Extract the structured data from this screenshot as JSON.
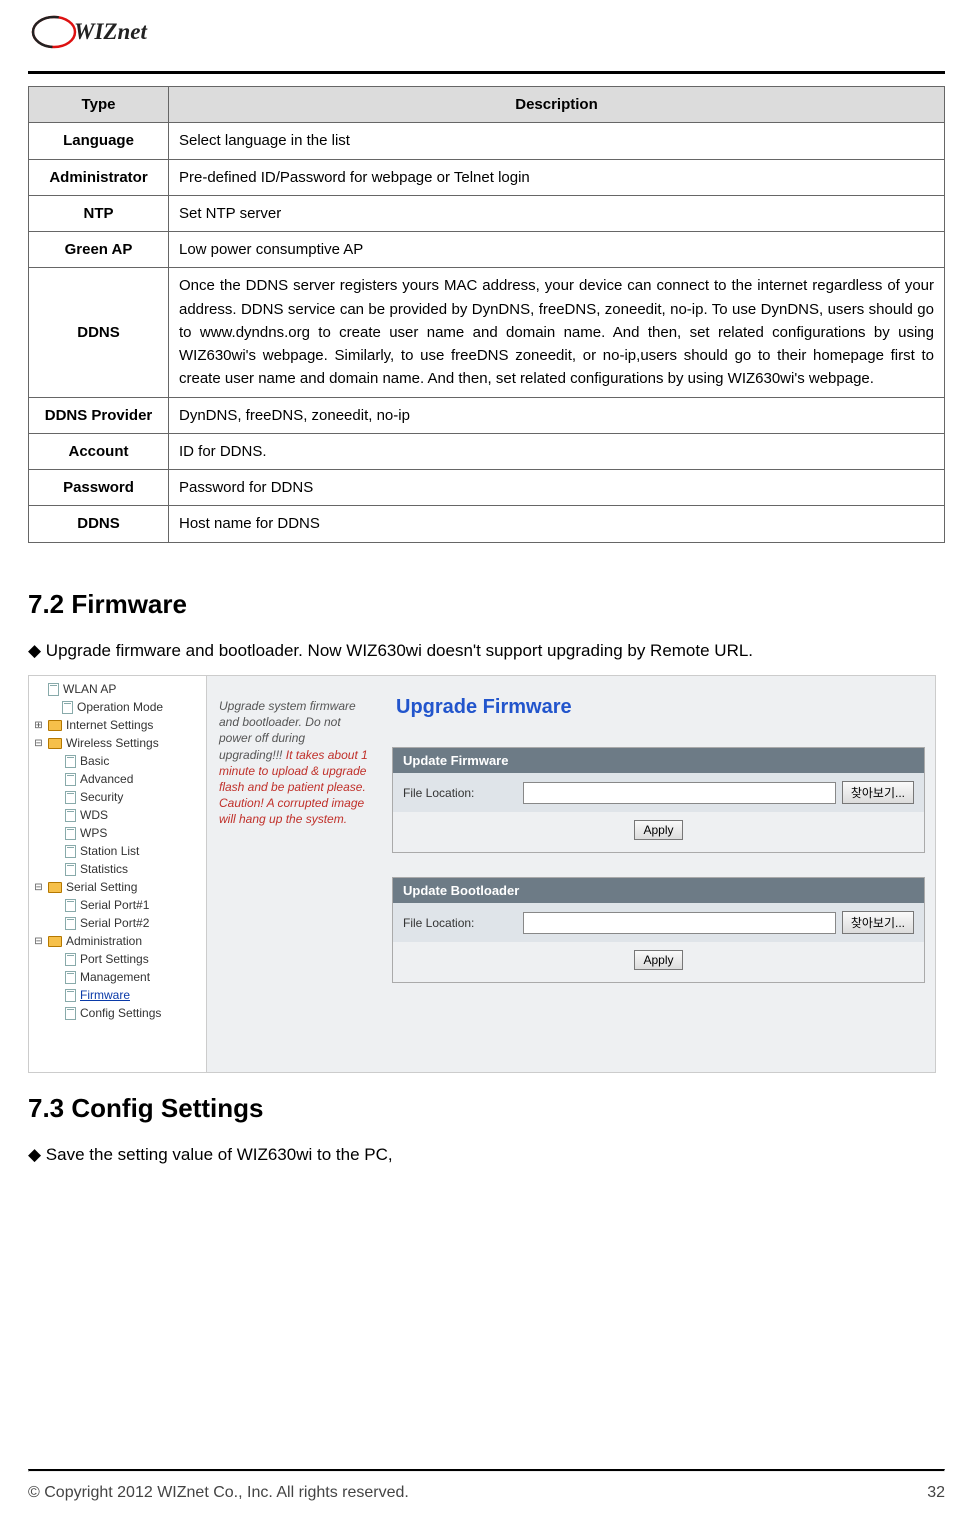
{
  "logo_text": "WIZnet",
  "table": {
    "head": {
      "type": "Type",
      "desc": "Description"
    },
    "rows": [
      {
        "type": "Language",
        "desc": "Select language in the list"
      },
      {
        "type": "Administrator",
        "desc": "Pre-defined ID/Password for webpage or Telnet login"
      },
      {
        "type": "NTP",
        "desc": "Set NTP server"
      },
      {
        "type": "Green AP",
        "desc": "Low power consumptive AP"
      },
      {
        "type": "DDNS",
        "desc": "Once the DDNS server registers yours MAC address, your device can connect to the internet regardless of your address. DDNS service can be provided by DynDNS, freeDNS, zoneedit, no-ip.\nTo use DynDNS, users should go to www.dyndns.org to create user name and domain name. And then, set related configurations by using WIZ630wi's webpage. Similarly, to use freeDNS zoneedit, or no-ip,users should go to their homepage first to create user name and domain name. And then, set related configurations by using WIZ630wi's webpage."
      },
      {
        "type": "DDNS Provider",
        "desc": "DynDNS, freeDNS, zoneedit, no-ip"
      },
      {
        "type": "Account",
        "desc": "ID for DDNS."
      },
      {
        "type": "Password",
        "desc": "Password for DDNS"
      },
      {
        "type": "DDNS",
        "desc": "Host name for DDNS"
      }
    ]
  },
  "sec_firmware": "7.2  Firmware",
  "bullet_firmware": "◆ Upgrade firmware and bootloader.   Now WIZ630wi doesn't support upgrading by Remote URL.",
  "sec_config": "7.3  Config Settings",
  "bullet_config": "◆ Save the setting value of WIZ630wi to the PC,",
  "tree": {
    "root": "WLAN AP",
    "op_mode": "Operation Mode",
    "internet": "Internet Settings",
    "wireless": "Wireless Settings",
    "basic": "Basic",
    "advanced": "Advanced",
    "security": "Security",
    "wds": "WDS",
    "wps": "WPS",
    "station_list": "Station List",
    "statistics": "Statistics",
    "serial": "Serial Setting",
    "sp1": "Serial Port#1",
    "sp2": "Serial Port#2",
    "admin": "Administration",
    "port_settings": "Port Settings",
    "management": "Management",
    "firmware": "Firmware",
    "config_settings": "Config Settings"
  },
  "hint": {
    "line1": "Upgrade system firmware and bootloader. Do not power off during upgrading!!!",
    "warn": "It takes about 1 minute to upload & upgrade flash and be patient please. Caution! A corrupted image will hang up the system."
  },
  "panel": {
    "title": "Upgrade Firmware",
    "box1_title": "Update Firmware",
    "box2_title": "Update Bootloader",
    "file_label": "File Location:",
    "browse": "찾아보기...",
    "apply": "Apply"
  },
  "footer": {
    "copyright": "© Copyright 2012 WIZnet Co., Inc. All rights reserved.",
    "page": "32"
  }
}
